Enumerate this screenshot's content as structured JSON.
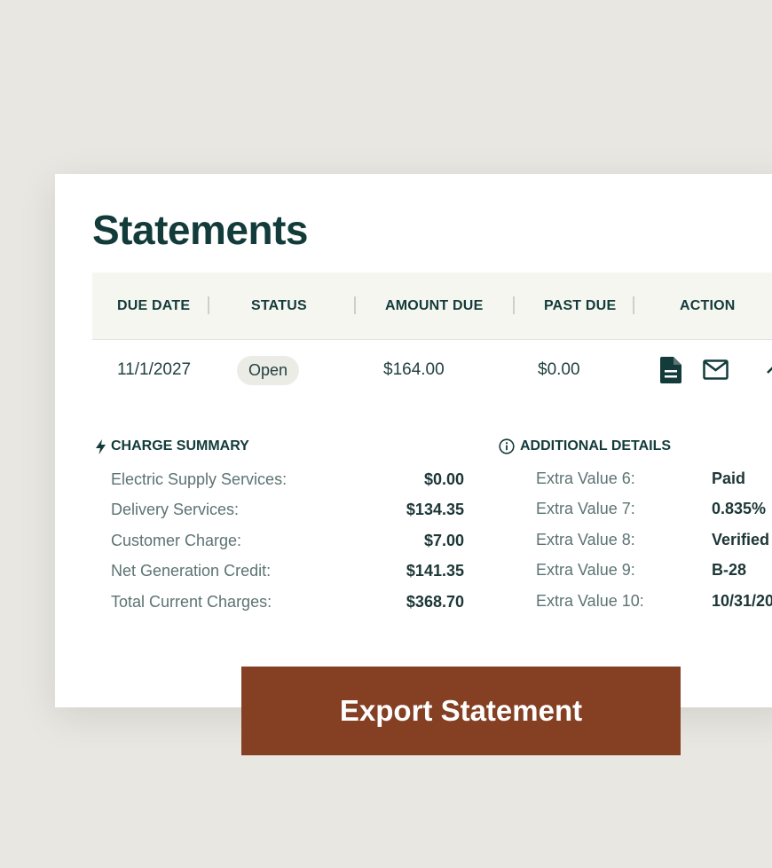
{
  "page": {
    "title": "Statements"
  },
  "table": {
    "headers": {
      "due_date": "DUE DATE",
      "status": "STATUS",
      "amount_due": "AMOUNT DUE",
      "past_due": "PAST DUE",
      "action": "ACTION"
    },
    "row": {
      "due_date": "11/1/2027",
      "status": "Open",
      "amount_due": "$164.00",
      "past_due": "$0.00",
      "actions": [
        "document-icon",
        "mail-icon",
        "chevron-up-icon"
      ]
    }
  },
  "charge_summary": {
    "title": "CHARGE SUMMARY",
    "icon": "lightning-icon",
    "items": [
      {
        "label": "Electric Supply Services:",
        "value": "$0.00"
      },
      {
        "label": "Delivery Services:",
        "value": "$134.35"
      },
      {
        "label": "Customer Charge:",
        "value": "$7.00"
      },
      {
        "label": "Net Generation Credit:",
        "value": "$141.35"
      },
      {
        "label": "Total Current Charges:",
        "value": "$368.70"
      }
    ]
  },
  "additional_details": {
    "title": "ADDITIONAL DETAILS",
    "icon": "info-icon",
    "items": [
      {
        "label": "Extra Value 6:",
        "value": "Paid"
      },
      {
        "label": "Extra Value 7:",
        "value": "0.835%"
      },
      {
        "label": "Extra Value 8:",
        "value": "Verified"
      },
      {
        "label": "Extra Value 9:",
        "value": "B-28"
      },
      {
        "label": "Extra Value 10:",
        "value": "10/31/20"
      }
    ]
  },
  "export_button": {
    "label": "Export Statement"
  },
  "colors": {
    "background": "#e8e7e1",
    "primary_text": "#123b3a",
    "header_bg": "#f6f6f0",
    "button": "#853f23"
  }
}
